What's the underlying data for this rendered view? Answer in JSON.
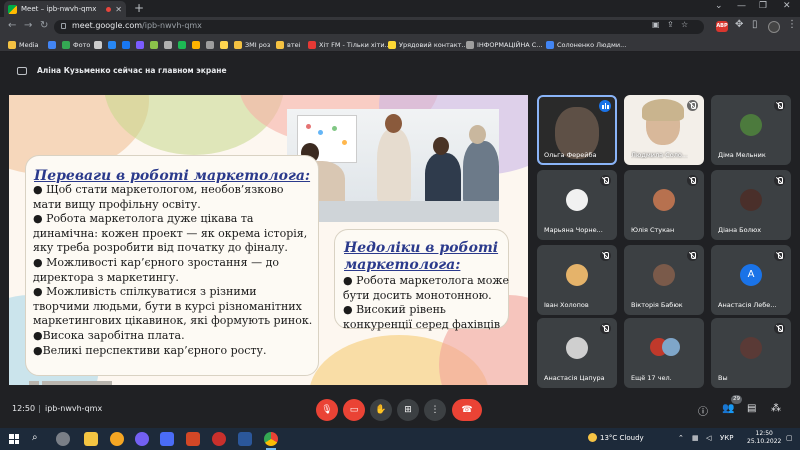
{
  "browser": {
    "tab_title": "Meet – ipb-nwvh-qmx",
    "url_host": "meet.google.com",
    "url_path": "/ipb-nwvh-qmx",
    "abp_label": "ABP",
    "bookmarks": [
      {
        "label": "Media",
        "color": "#f5c242"
      },
      {
        "label": "",
        "color": "#4285f4"
      },
      {
        "label": "Фото",
        "color": "#34a853"
      },
      {
        "label": "",
        "color": "#cccccc"
      },
      {
        "label": "",
        "color": "#2787f5"
      },
      {
        "label": "",
        "color": "#1877f2"
      },
      {
        "label": "",
        "color": "#7b5cff"
      },
      {
        "label": "",
        "color": "#8bc34a"
      },
      {
        "label": "",
        "color": "#b0b0b0"
      },
      {
        "label": "",
        "color": "#1db954"
      },
      {
        "label": "",
        "color": "#ffb300"
      },
      {
        "label": "",
        "color": "#9e9e9e"
      },
      {
        "label": "",
        "color": "#ffd54f"
      },
      {
        "label": "ЗМІ роз",
        "color": "#f5c242"
      },
      {
        "label": "втеі",
        "color": "#f5c242"
      },
      {
        "label": "Хіт FM - Тільки хіти...",
        "color": "#e53935"
      },
      {
        "label": "Урядовий контакт...",
        "color": "#fdd835"
      },
      {
        "label": "ІНФОРМАЦІЙНА С...",
        "color": "#9e9e9e"
      },
      {
        "label": "Солоненко Людми...",
        "color": "#4285f4"
      }
    ]
  },
  "meeting": {
    "presenter_text": "Аліна Кузьменко сейчас на главном экране",
    "time": "12:50",
    "separator": "|",
    "code": "ipb-nwvh-qmx",
    "people_badge": "29"
  },
  "slide": {
    "box1": {
      "title": "Переваги в роботі маркетолога:",
      "lines": [
        "●  Щоб стати маркетологом, необов’язково",
        "мати вищу профільну освіту.",
        "●  Робота маркетолога дуже цікава та",
        "динамічна: кожен проект — як окрема історія,",
        "яку треба розробити від початку до фіналу.",
        "●  Можливості кар’єрного зростання — до",
        "директора з маркетингу.",
        "●  Можливість спілкуватися з різними",
        "творчими людьми, бути в курсі різноманітних",
        "маркетингових цікавинок, які формують ринок.",
        "●Висока заробітна плата.",
        "●Великі перспективи кар’єрного росту."
      ]
    },
    "box2": {
      "title_line1": "Недоліки в роботі",
      "title_line2": "маркетолога:",
      "lines": [
        "●  Робота маркетолога може",
        "бути досить монотонною.",
        "●  Високий рівень",
        "конкуренції серед фахівців"
      ]
    }
  },
  "tiles": [
    {
      "name": "Ольга Ферейба",
      "state": "speaking",
      "bg": "#2a2a2a"
    },
    {
      "name": "Людмила Соло...",
      "state": "muted",
      "bg": "#f3efe9"
    },
    {
      "name": "Діма Мельник",
      "state": "muted",
      "bg": "#3c4043"
    },
    {
      "name": "Марьяна Чорне...",
      "state": "muted",
      "bg": "#3c4043"
    },
    {
      "name": "Юлія Стукан",
      "state": "muted",
      "bg": "#3c4043"
    },
    {
      "name": "Діана Болюх",
      "state": "muted",
      "bg": "#3c4043"
    },
    {
      "name": "Іван Холопов",
      "state": "muted",
      "bg": "#3c4043"
    },
    {
      "name": "Вікторія Бабюк",
      "state": "muted",
      "bg": "#3c4043"
    },
    {
      "name": "Анастасія Лебе...",
      "state": "muted",
      "bg": "#3c4043",
      "letter": "А"
    },
    {
      "name": "Анастасія Цапура",
      "state": "muted",
      "bg": "#3c4043"
    },
    {
      "name": "Ещё 17 чел.",
      "state": "none",
      "bg": "#3c4043"
    },
    {
      "name": "Вы",
      "state": "muted",
      "bg": "#3c4043"
    }
  ],
  "taskbar": {
    "weather": "13°C  Cloudy",
    "lang": "УКР",
    "time": "12:50",
    "date": "25.10.2022"
  }
}
